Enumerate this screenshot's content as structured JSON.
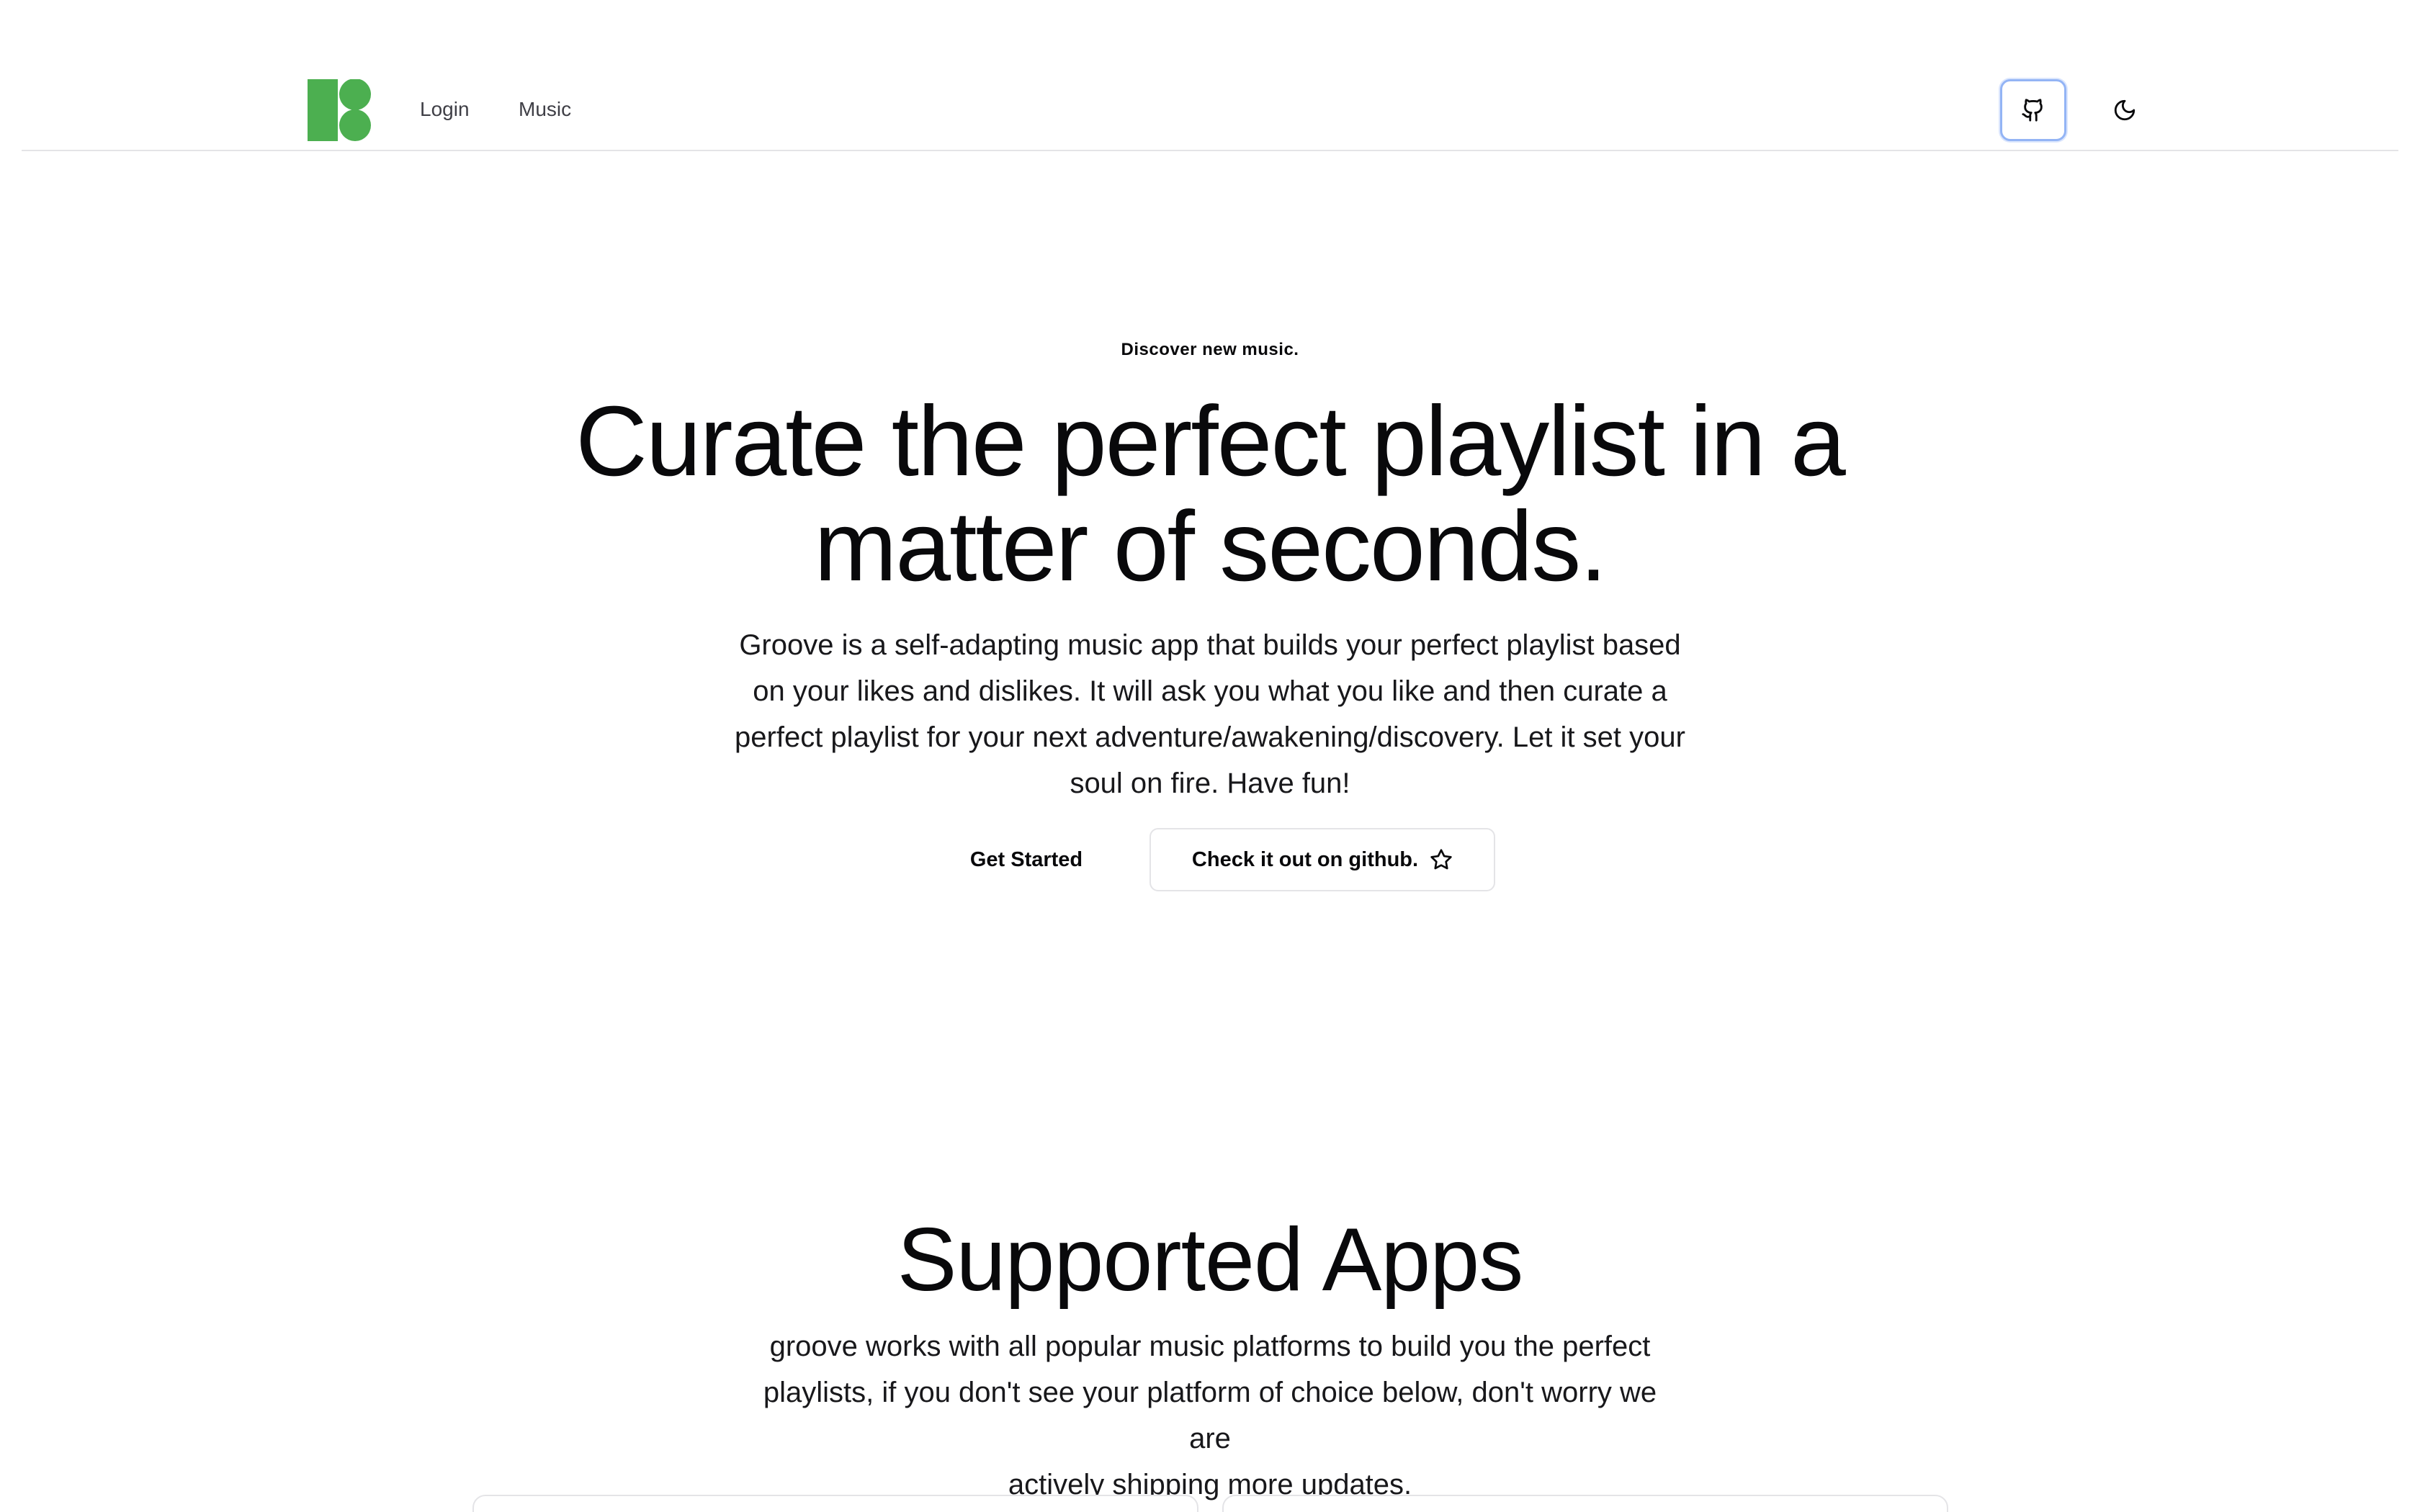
{
  "header": {
    "logo_name": "groove-logo",
    "nav": {
      "login": "Login",
      "music": "Music"
    },
    "github_icon": "github-icon",
    "theme_icon": "moon-icon"
  },
  "hero": {
    "eyebrow": "Discover new music.",
    "title_line1": "Curate the perfect playlist in a",
    "title_line2": "matter of seconds.",
    "description_line1": "Groove is a self-adapting music app that builds your perfect playlist based",
    "description_line2": "on your likes and dislikes. It will ask you what you like and then curate a",
    "description_line3": "perfect playlist for your next adventure/awakening/discovery. Let it set your",
    "description_line4": "soul on fire. Have fun!",
    "get_started": "Get Started",
    "github_cta": "Check it out on github.",
    "star_icon": "star-icon"
  },
  "supported": {
    "title": "Supported Apps",
    "description_line1": "groove works with all popular music platforms to build you the perfect",
    "description_line2": "playlists, if you don't see your platform of choice below, don't worry we are",
    "description_line3": "actively shipping more updates."
  },
  "colors": {
    "brand_green": "#4caf50",
    "focus_ring": "#93b4f5",
    "text": "#09090b",
    "border": "#e4e4e7"
  }
}
